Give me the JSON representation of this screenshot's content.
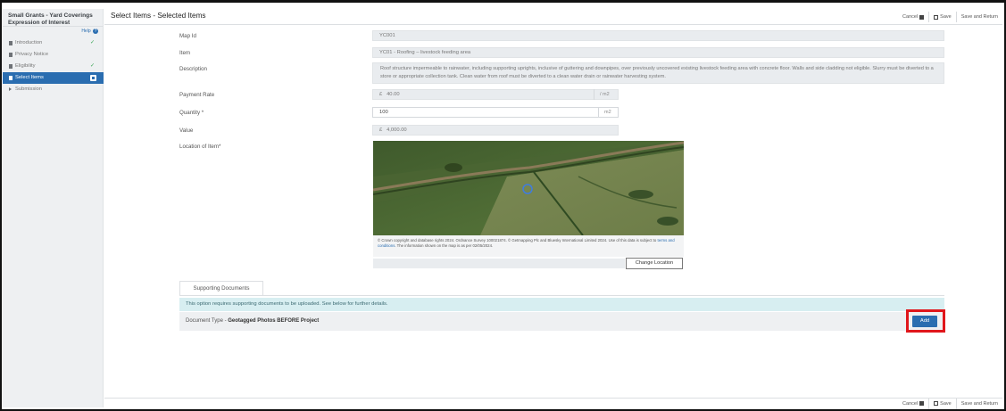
{
  "app": {
    "title_line1": "Small Grants - Yard Coverings",
    "title_line2": "Expression of Interest",
    "help_label": "Help"
  },
  "sidebar": {
    "items": [
      {
        "label": "Introduction",
        "complete": true
      },
      {
        "label": "Privacy Notice",
        "complete": false
      },
      {
        "label": "Eligibility",
        "complete": true
      },
      {
        "label": "Select Items",
        "active": true
      },
      {
        "label": "Submission",
        "complete": false
      }
    ],
    "check_glyph": "✓"
  },
  "header": {
    "title": "Select Items - Selected Items"
  },
  "actions": {
    "cancel": "Cancel",
    "save": "Save",
    "save_return": "Save and Return"
  },
  "form": {
    "map_id": {
      "label": "Map Id",
      "value": "YC001"
    },
    "item": {
      "label": "Item",
      "value": "YC01 - Roofing – livestock feeding area"
    },
    "description": {
      "label": "Description",
      "value": "Roof structure impermeable to rainwater, including supporting uprights, inclusive of guttering and downpipes, over previously uncovered existing livestock feeding area with concrete floor. Walls and side cladding not eligible. Slurry must be diverted to a store or appropriate collection tank. Clean water from roof must be diverted to a clean water drain or rainwater harvesting system."
    },
    "payment_rate": {
      "label": "Payment Rate",
      "currency": "£",
      "value": "40.00",
      "unit": "/ m2"
    },
    "quantity": {
      "label": "Quantity *",
      "value": "100",
      "unit": "m2"
    },
    "value": {
      "label": "Value",
      "currency": "£",
      "value": "4,000.00"
    },
    "location": {
      "label": "Location of Item*"
    }
  },
  "map": {
    "caption_part1": "© Crown copyright and database rights 2024. Ordnance Survey 100021874. © Getmapping Plc and Bluesky International Limited 2024. Use of this data is subject to",
    "caption_link": "terms and conditions",
    "caption_part2": ". The information shown on the map is as per 02/05/2024.",
    "change_location": "Change Location"
  },
  "supporting": {
    "tab_label": "Supporting Documents",
    "info": "This option requires supporting documents to be uploaded. See below for further details.",
    "doc_type_prefix": "Document Type - ",
    "doc_type": "Geotagged Photos BEFORE Project",
    "add_label": "Add"
  },
  "colors": {
    "accent": "#2a6db0",
    "highlight": "#e0161b",
    "info_bg": "#d7eef1"
  }
}
